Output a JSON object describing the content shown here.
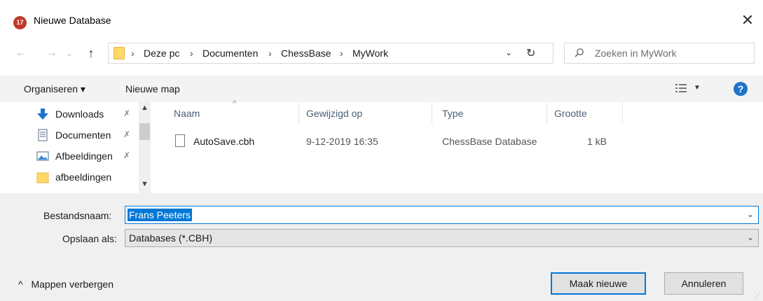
{
  "window": {
    "title": "Nieuwe Database",
    "app_icon_text": "17",
    "close_symbol": "✕"
  },
  "nav": {
    "back_symbol": "←",
    "forward_symbol": "→",
    "recent_symbol": "⌄",
    "up_symbol": "↑",
    "breadcrumbs": [
      "Deze pc",
      "Documenten",
      "ChessBase",
      "MyWork"
    ],
    "separator": "›",
    "dropdown_symbol": "⌄",
    "refresh_symbol": "↻",
    "search_placeholder": "Zoeken in MyWork"
  },
  "toolbar": {
    "organize_label": "Organiseren ▾",
    "new_folder_label": "Nieuwe map",
    "help_symbol": "?"
  },
  "navpane": {
    "items": [
      {
        "label": "Downloads",
        "icon": "download-arrow-icon",
        "pinned": true
      },
      {
        "label": "Documenten",
        "icon": "document-icon",
        "pinned": true
      },
      {
        "label": "Afbeeldingen",
        "icon": "picture-icon",
        "pinned": true
      },
      {
        "label": "afbeeldingen",
        "icon": "folder-icon",
        "pinned": false
      }
    ],
    "pin_symbol": "📌"
  },
  "filelist": {
    "columns": [
      "Naam",
      "Gewijzigd op",
      "Type",
      "Grootte"
    ],
    "rows": [
      {
        "name": "AutoSave.cbh",
        "modified": "9-12-2019 16:35",
        "type": "ChessBase Database",
        "size": "1 kB"
      }
    ]
  },
  "save": {
    "filename_label": "Bestandsnaam:",
    "filename_value": "Frans Peeters",
    "type_label": "Opslaan als:",
    "type_value": "Databases (*.CBH)",
    "toggle_label": "Mappen verbergen",
    "toggle_symbol": "^",
    "primary_button": "Maak nieuwe",
    "cancel_button": "Annuleren"
  },
  "colors": {
    "accent": "#0078d7",
    "help": "#1f73cc",
    "app_icon": "#c0392b",
    "folder": "#ffd866"
  }
}
